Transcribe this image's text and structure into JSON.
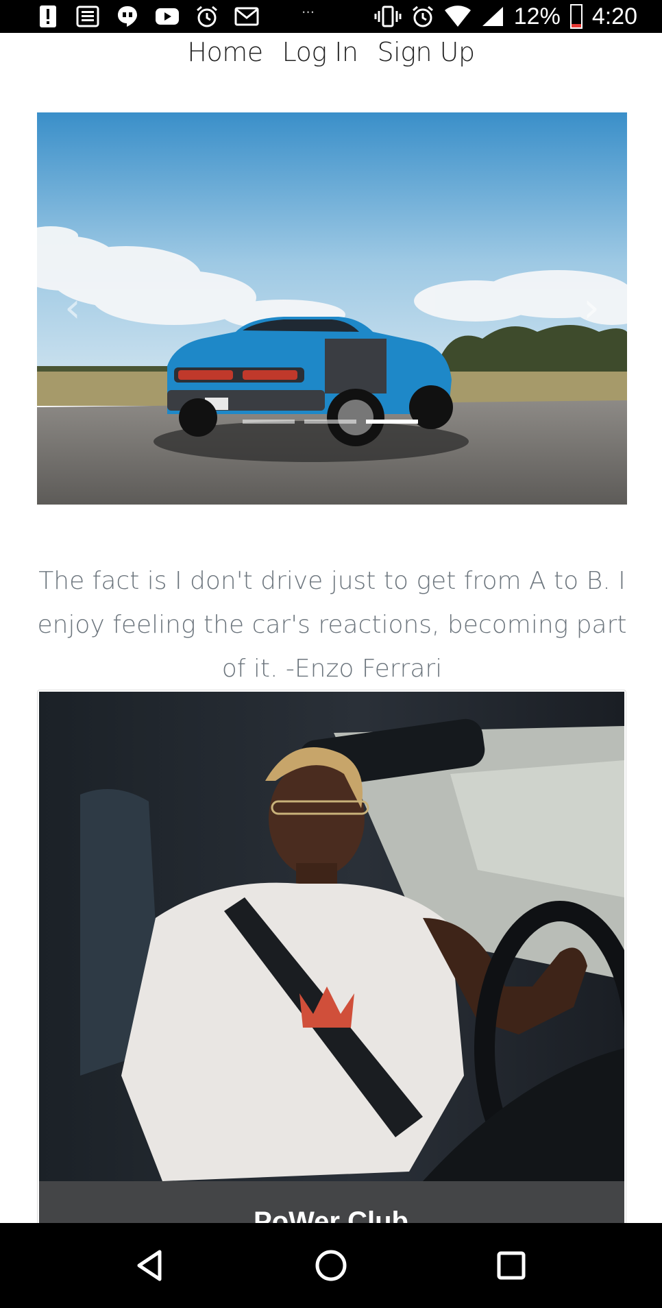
{
  "status_bar": {
    "icons_left": [
      "alert-icon",
      "news-icon",
      "hangouts-icon",
      "youtube-icon",
      "alarm-icon",
      "gmail-icon"
    ],
    "more": "···",
    "battery": "12%",
    "time": "4:20"
  },
  "nav": {
    "items": [
      "Home",
      "Log In",
      "Sign Up"
    ]
  },
  "carousel": {
    "prev": "‹",
    "next": "›",
    "slides": 3,
    "active_index": 2
  },
  "quote": {
    "text": "The fact is I don't drive just to get from A to B. I enjoy feeling the car's reactions, becoming part of it. -Enzo Ferrari"
  },
  "card": {
    "title": "PoWer Club"
  },
  "colors": {
    "car_blue": "#1e88c8",
    "card_footer": "#444547",
    "quote_text": "#6c757d"
  }
}
